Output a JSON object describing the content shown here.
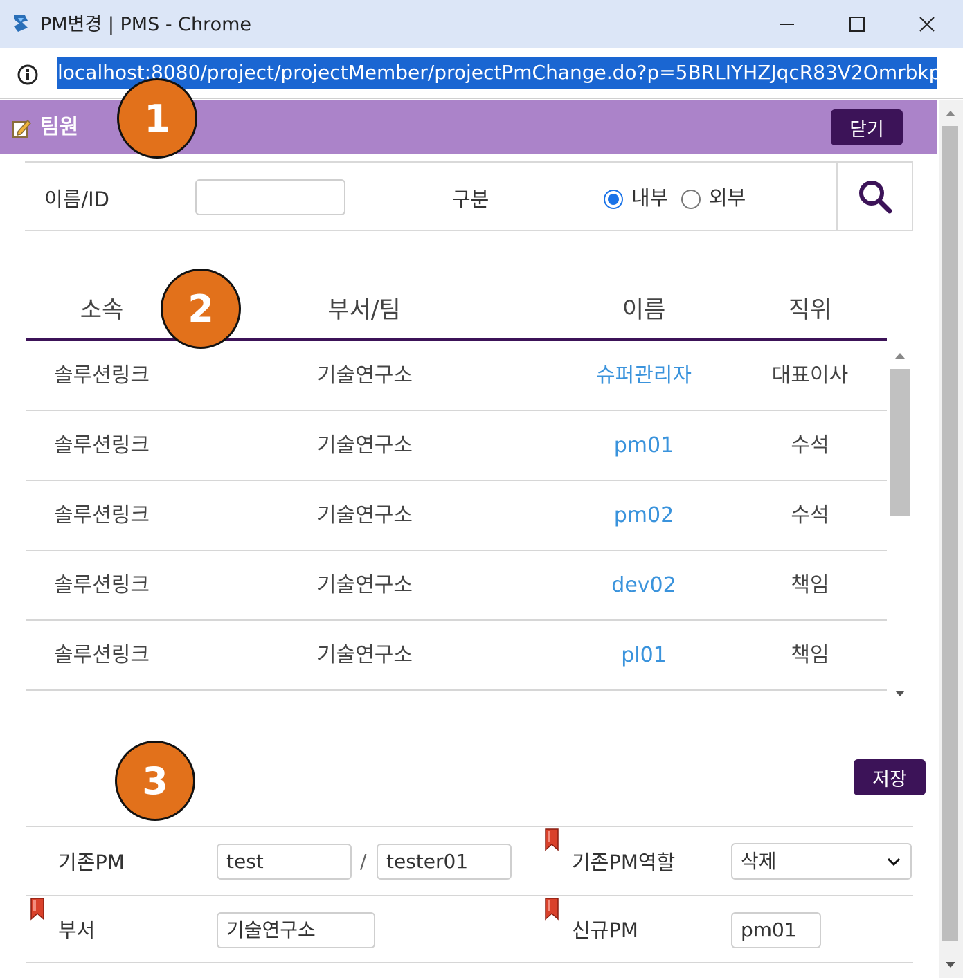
{
  "window": {
    "title": "PM변경 | PMS - Chrome",
    "url": "localhost:8080/project/projectMember/projectPmChange.do?p=5BRLIYHZJqcR83V2Omrbkp"
  },
  "popup": {
    "title": "팀원",
    "close_label": "닫기"
  },
  "search": {
    "name_label": "이름/ID",
    "name_value": "",
    "type_label": "구분",
    "radio_internal": "내부",
    "radio_external": "외부",
    "selected": "내부"
  },
  "table": {
    "headers": [
      "소속",
      "부서/팀",
      "이름",
      "직위"
    ],
    "rows": [
      [
        "솔루션링크",
        "기술연구소",
        "슈퍼관리자",
        "대표이사"
      ],
      [
        "솔루션링크",
        "기술연구소",
        "pm01",
        "수석"
      ],
      [
        "솔루션링크",
        "기술연구소",
        "pm02",
        "수석"
      ],
      [
        "솔루션링크",
        "기술연구소",
        "dev02",
        "책임"
      ],
      [
        "솔루션링크",
        "기술연구소",
        "pl01",
        "책임"
      ]
    ]
  },
  "form": {
    "save_label": "저장",
    "prev_pm_label": "기존PM",
    "prev_pm_name": "test",
    "separator": "/",
    "prev_pm_id": "tester01",
    "prev_pm_role_label": "기존PM역할",
    "prev_pm_role_value": "삭제",
    "dept_label": "부서",
    "dept_value": "기술연구소",
    "new_pm_label": "신규PM",
    "new_pm_value": "pm01"
  },
  "annotations": [
    "1",
    "2",
    "3"
  ],
  "colors": {
    "header_bg": "#ab83c9",
    "button_bg": "#3c1358",
    "link": "#3a93dc",
    "badge": "#e2711b",
    "url_highlight": "#1a66d2"
  },
  "icons": [
    "app-icon",
    "info-icon",
    "edit-icon",
    "search-icon",
    "bookmark-icon",
    "chevron-down-icon"
  ]
}
